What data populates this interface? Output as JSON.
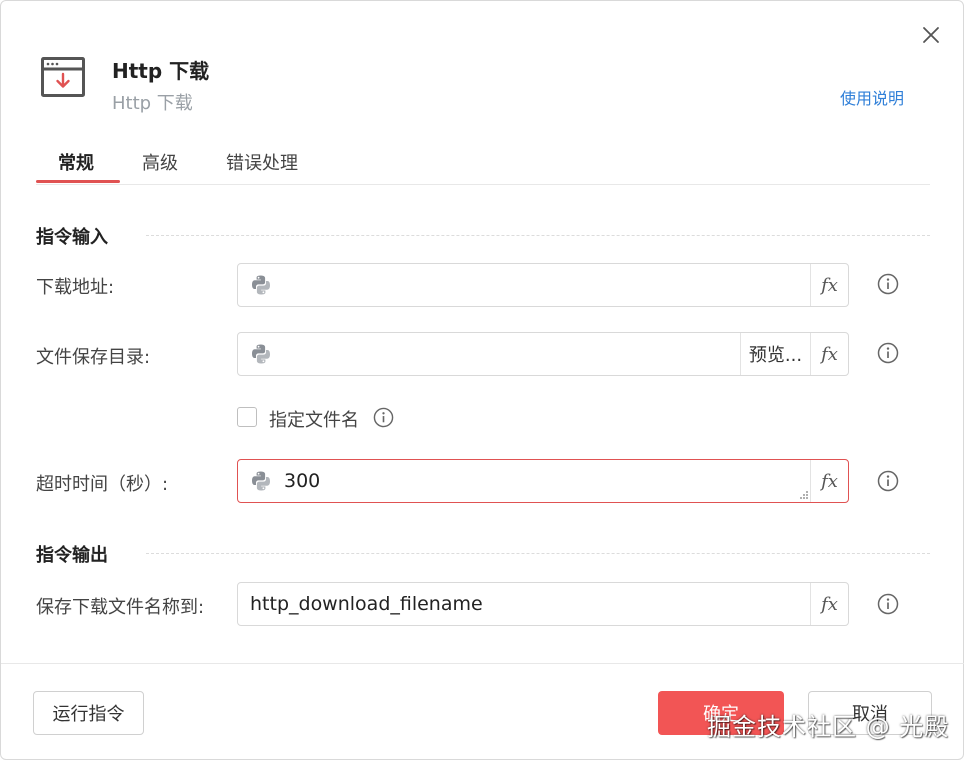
{
  "dialog": {
    "title": "Http 下载",
    "subtitle": "Http 下载",
    "help_link": "使用说明"
  },
  "tabs": [
    {
      "label": "常规",
      "active": true
    },
    {
      "label": "高级",
      "active": false
    },
    {
      "label": "错误处理",
      "active": false
    }
  ],
  "sections": {
    "input_title": "指令输入",
    "output_title": "指令输出"
  },
  "fields": {
    "download_url": {
      "label": "下载地址:",
      "value": ""
    },
    "save_dir": {
      "label": "文件保存目录:",
      "value": "",
      "browse_label": "预览..."
    },
    "specify_filename": {
      "label": "指定文件名",
      "checked": false
    },
    "timeout": {
      "label": "超时时间（秒）:",
      "value": "300"
    },
    "output_var": {
      "label": "保存下载文件名称到:",
      "value": "http_download_filename"
    }
  },
  "fx_label": "fx",
  "buttons": {
    "run": "运行指令",
    "ok": "确定",
    "cancel": "取消"
  },
  "watermark": "掘金技术社区 @ 光殿",
  "colors": {
    "accent": "#f25555",
    "link": "#2f7fd8",
    "tab_underline": "#e05252"
  },
  "icons": [
    "close-icon",
    "download-window-icon",
    "python-icon",
    "info-icon"
  ]
}
